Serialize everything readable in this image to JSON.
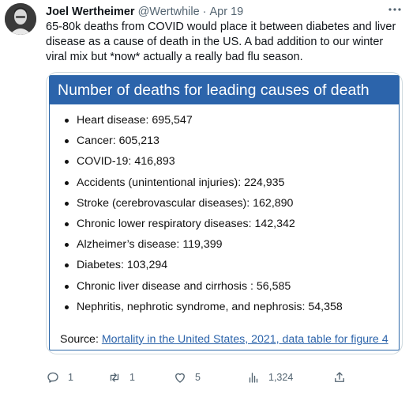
{
  "tweet": {
    "author_name": "Joel Wertheimer",
    "handle": "@Wertwhile",
    "separator": "·",
    "date": "Apr 19",
    "more_icon": "more-horizontal-icon",
    "text": "65-80k deaths from COVID would place it between diabetes and liver disease as a cause of death in the US. A bad addition to our winter viral mix but *now* actually a really bad flu season."
  },
  "card": {
    "title": "Number of deaths for leading causes of death",
    "items": [
      "Heart disease: 695,547",
      "Cancer: 605,213",
      "COVID-19: 416,893",
      "Accidents (unintentional injuries): 224,935",
      "Stroke (cerebrovascular diseases): 162,890",
      "Chronic lower respiratory diseases: 142,342",
      "Alzheimer’s disease: 119,399",
      "Diabetes: 103,294",
      "Chronic liver disease and cirrhosis : 56,585",
      "Nephritis, nephrotic syndrome, and nephrosis: 54,358"
    ],
    "source_label": "Source: ",
    "source_link": "Mortality in the United States, 2021, data table for figure 4",
    "title_color": "#2c64ab"
  },
  "actions": {
    "reply_count": "1",
    "retweet_count": "1",
    "like_count": "5",
    "views_count": "1,324",
    "icons": [
      "reply-icon",
      "retweet-icon",
      "like-icon",
      "views-icon",
      "share-icon"
    ]
  }
}
